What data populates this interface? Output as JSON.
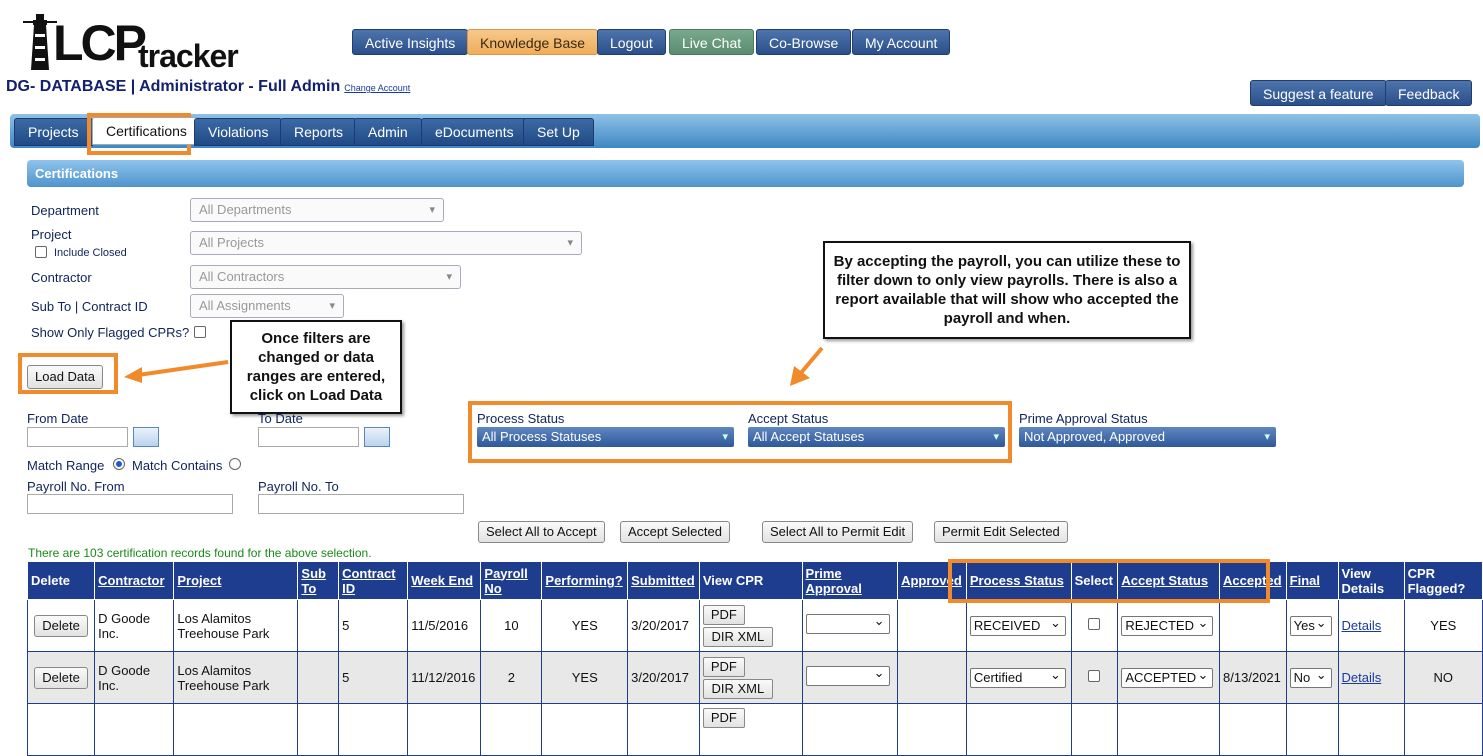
{
  "header": {
    "logo_text": "LCPtracker",
    "account_title": "DG- DATABASE | Administrator - Full Admin",
    "change_account": "Change Account"
  },
  "top_buttons": [
    "Active Insights",
    "Knowledge Base",
    "Logout",
    "Live Chat",
    "Co-Browse",
    "My Account"
  ],
  "right_buttons": [
    "Suggest a feature",
    "Feedback"
  ],
  "tabs": [
    "Projects",
    "Certifications",
    "Violations",
    "Reports",
    "Admin",
    "eDocuments",
    "Set Up"
  ],
  "section_title": "Certifications",
  "filters": {
    "department_label": "Department",
    "department_value": "All Departments",
    "project_label": "Project",
    "include_closed": "Include Closed",
    "project_value": "All Projects",
    "contractor_label": "Contractor",
    "contractor_value": "All Contractors",
    "subto_label": "Sub To | Contract ID",
    "subto_value": "All Assignments",
    "flagged_label": "Show Only Flagged CPRs?",
    "load_data": "Load Data",
    "from_date": "From Date",
    "to_date": "To Date",
    "match_range": "Match Range",
    "match_contains": "Match Contains",
    "payroll_from": "Payroll No. From",
    "payroll_to": "Payroll No. To",
    "process_status_label": "Process Status",
    "process_status_value": "All Process Statuses",
    "accept_status_label": "Accept Status",
    "accept_status_value": "All Accept Statuses",
    "prime_label": "Prime Approval Status",
    "prime_value": "Not Approved, Approved"
  },
  "actions": [
    "Select All to Accept",
    "Accept Selected",
    "Select All to Permit Edit",
    "Permit Edit Selected"
  ],
  "result_text": "There are 103 certification records found for the above selection.",
  "callouts": {
    "left": "Once filters are changed or data ranges are entered, click on Load Data",
    "right": "By accepting the payroll, you can utilize these to filter down to only view payrolls. There is also a report available that will show who accepted the payroll and when."
  },
  "table": {
    "headers": [
      "Delete",
      "Contractor",
      "Project",
      "Sub To",
      "Contract ID",
      "Week End",
      "Payroll No",
      "Performing?",
      "Submitted",
      "View CPR",
      "Prime Approval",
      "Approved",
      "Process Status",
      "Select",
      "Accept Status",
      "Accepted",
      "Final",
      "View Details",
      "CPR Flagged?"
    ],
    "rows": [
      {
        "delete": "Delete",
        "contractor": "D Goode Inc.",
        "project": "Los Alamitos Treehouse Park",
        "sub_to": "",
        "contract_id": "5",
        "week_end": "11/5/2016",
        "payroll_no": "10",
        "performing": "YES",
        "submitted": "3/20/2017",
        "pdf": "PDF",
        "xml": "DIR XML",
        "prime": "",
        "approved": "",
        "process": "RECEIVED",
        "accept": "REJECTED",
        "accepted": "",
        "final": "Yes",
        "details": "Details",
        "flagged": "YES"
      },
      {
        "delete": "Delete",
        "contractor": "D Goode Inc.",
        "project": "Los Alamitos Treehouse Park",
        "sub_to": "",
        "contract_id": "5",
        "week_end": "11/12/2016",
        "payroll_no": "2",
        "performing": "YES",
        "submitted": "3/20/2017",
        "pdf": "PDF",
        "xml": "DIR XML",
        "prime": "",
        "approved": "",
        "process": "Certified",
        "accept": "ACCEPTED",
        "accepted": "8/13/2021",
        "final": "No",
        "details": "Details",
        "flagged": "NO"
      }
    ],
    "partial_row_pdf": "PDF"
  }
}
